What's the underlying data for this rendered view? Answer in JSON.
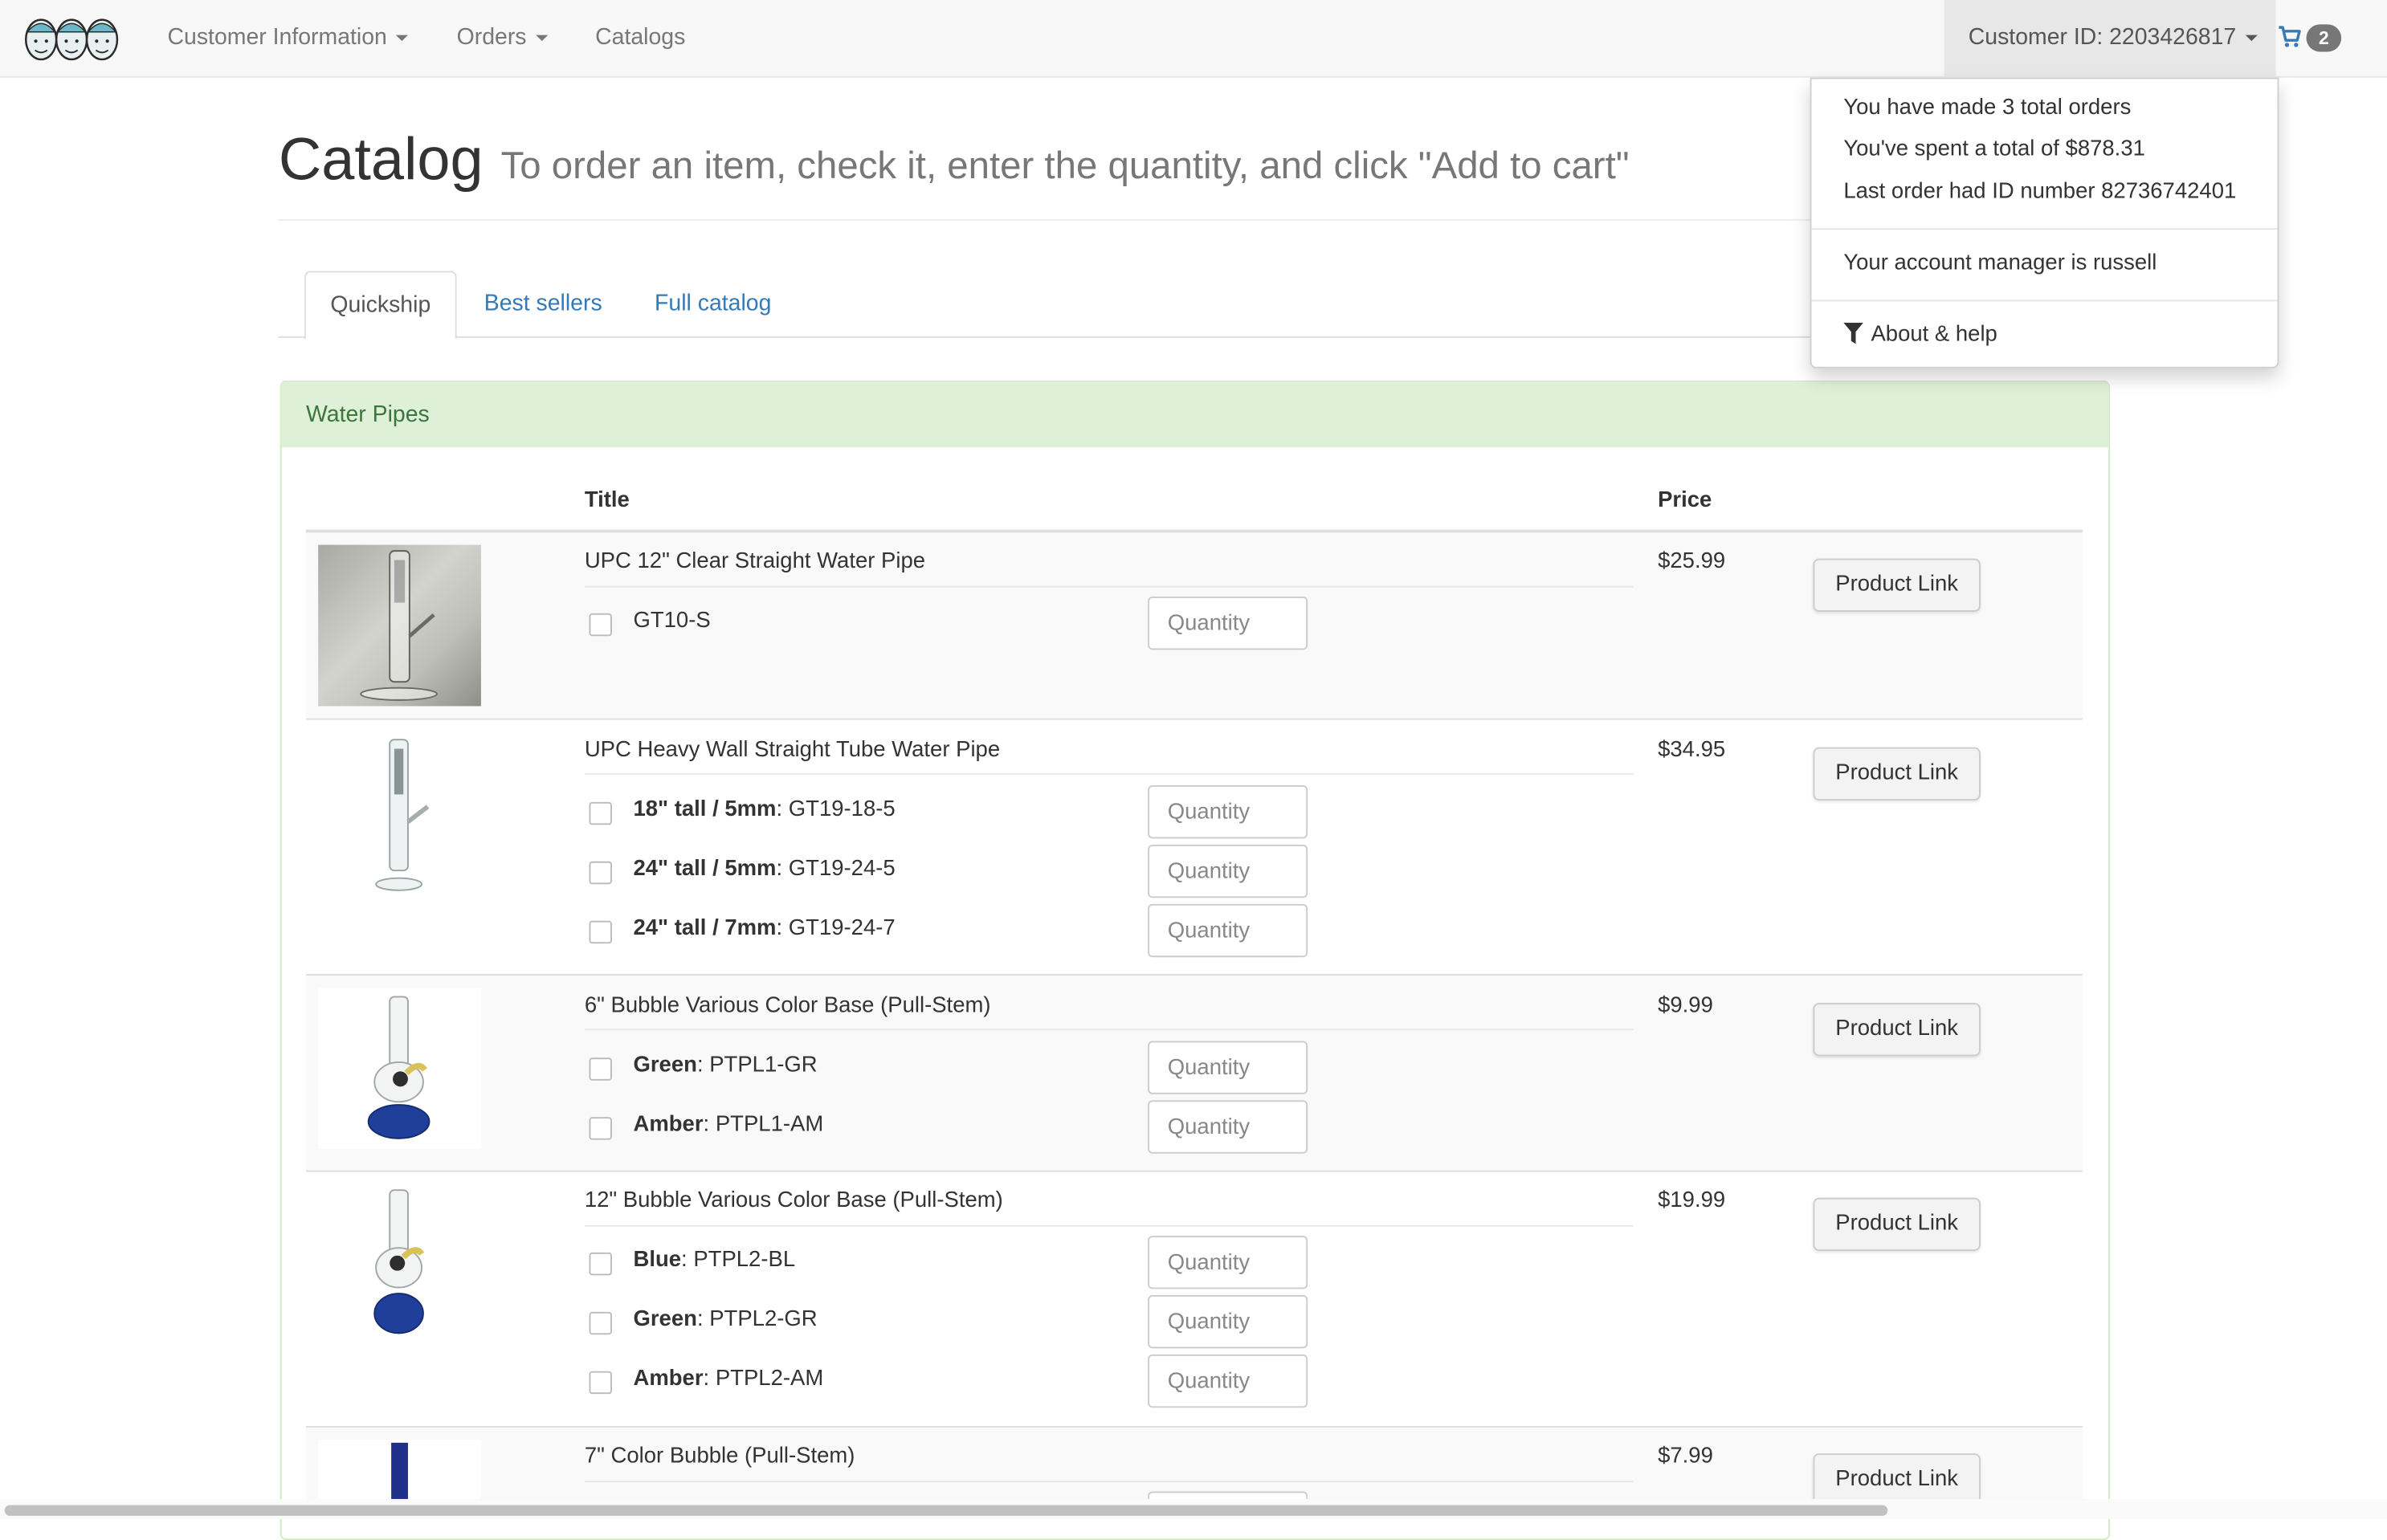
{
  "navbar": {
    "menu": [
      {
        "label": "Customer Information",
        "has_caret": true
      },
      {
        "label": "Orders",
        "has_caret": true
      },
      {
        "label": "Catalogs",
        "has_caret": false
      }
    ],
    "customer_label": "Customer ID: 2203426817",
    "cart_count": "2",
    "icons": [
      "logo-three-faces",
      "caret-down-icon",
      "cart-icon"
    ]
  },
  "customer_dropdown": {
    "lines": [
      "You have made 3 total orders",
      "You've spent a total of $878.31",
      "Last order had ID number 82736742401",
      "Your account manager is russell",
      "About & help"
    ],
    "help_icon": "filter-icon"
  },
  "header": {
    "title": "Catalog",
    "subtitle": "To order an item, check it, enter the quantity, and click \"Add to cart\""
  },
  "tabs": [
    "Quickship",
    "Best sellers",
    "Full catalog"
  ],
  "active_tab": "Quickship",
  "panel": {
    "heading": "Water Pipes",
    "columns": {
      "title": "Title",
      "price": "Price"
    }
  },
  "quantity_placeholder": "Quantity",
  "product_link_label": "Product Link",
  "products": [
    {
      "title": "UPC 12\" Clear Straight Water Pipe",
      "price": "$25.99",
      "variants": [
        {
          "name": "",
          "sku": "GT10-S"
        }
      ]
    },
    {
      "title": "UPC Heavy Wall Straight Tube Water Pipe",
      "price": "$34.95",
      "variants": [
        {
          "name": "18\" tall / 5mm",
          "sku": "GT19-18-5"
        },
        {
          "name": "24\" tall / 5mm",
          "sku": "GT19-24-5"
        },
        {
          "name": "24\" tall / 7mm",
          "sku": "GT19-24-7"
        }
      ]
    },
    {
      "title": "6\" Bubble Various Color Base (Pull-Stem)",
      "price": "$9.99",
      "variants": [
        {
          "name": "Green",
          "sku": "PTPL1-GR"
        },
        {
          "name": "Amber",
          "sku": "PTPL1-AM"
        }
      ]
    },
    {
      "title": "12\" Bubble Various Color Base (Pull-Stem)",
      "price": "$19.99",
      "variants": [
        {
          "name": "Blue",
          "sku": "PTPL2-BL"
        },
        {
          "name": "Green",
          "sku": "PTPL2-GR"
        },
        {
          "name": "Amber",
          "sku": "PTPL2-AM"
        }
      ]
    },
    {
      "title": "7\" Color Bubble (Pull-Stem)",
      "price": "$7.99",
      "variants": []
    }
  ],
  "colors": {
    "navbar_bg": "#f8f8f8",
    "link": "#337ab7",
    "panel_heading_bg": "#dff0d8",
    "panel_heading_text": "#3c763d",
    "row_stripe": "#f9f9f9",
    "cart_blue": "#337ab7"
  }
}
